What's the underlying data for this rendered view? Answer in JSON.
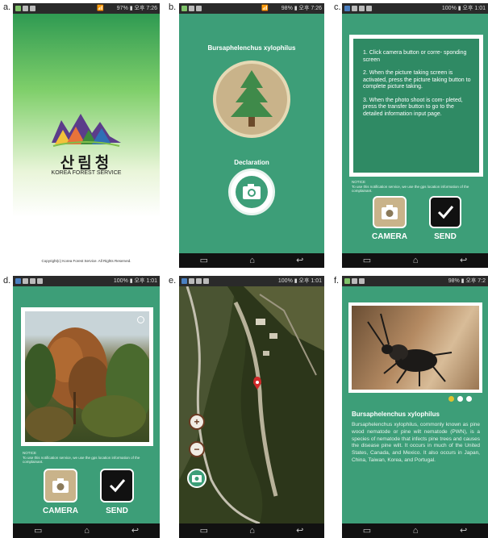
{
  "labels": [
    "a.",
    "b.",
    "c.",
    "d.",
    "e.",
    "f."
  ],
  "status": {
    "a": {
      "right": "📶           97% ▮ 오후 7:26"
    },
    "b": {
      "right": "📶           98% ▮ 오후 7:26"
    },
    "c": {
      "right": "100% ▮ 오후 1:01"
    },
    "d": {
      "right": "100% ▮ 오후 1:01"
    },
    "e": {
      "right": "100% ▮ 오후 1:01"
    },
    "f": {
      "right": "98% ▮ 오후 7:2"
    }
  },
  "splash": {
    "korean_name": "산림청",
    "english_name": "KOREA FOREST SERVICE",
    "copyright": "Copyright(c) Korea Forest Service. All Rights Reserved."
  },
  "home": {
    "title": "Bursaphelenchus xylophilus",
    "declaration_label": "Declaration"
  },
  "instructions": {
    "steps": [
      "1. Click camera button or corre- sponding screen",
      "2. When the picture taking screen is activated, press the picture taking button to complete picture taking.",
      "3. When the photo shoot is com- pleted, press the transfer button to go to the detailed information input page."
    ],
    "notice_title": "NOTICE",
    "notice_text": "To use this notification service, we use the gps location information of the complainant.",
    "camera_label": "CAMERA",
    "send_label": "SEND"
  },
  "photo": {
    "notice_title": "NOTICE",
    "notice_text": "To use this notification service, we use the gps location information of the complainant.",
    "camera_label": "CAMERA",
    "send_label": "SEND"
  },
  "detail": {
    "title": "Bursaphelenchus xylophilus",
    "body": "Bursaphelenchus xylophilus, commonly known as pine wood nematode or pine wilt nematode (PWN), is a species of nematode that infects pine trees and causes the disease pine wilt. It occurs in much of the United States, Canada, and Mexico. It also occurs in Japan, China, Taiwan, Korea, and Portugal."
  },
  "nav": {
    "recent": "▭",
    "home": "⌂",
    "back": "↩"
  },
  "colors": {
    "app_green": "#3d9e78",
    "card_green": "#2f8a64",
    "beige": "#c9b38a"
  }
}
